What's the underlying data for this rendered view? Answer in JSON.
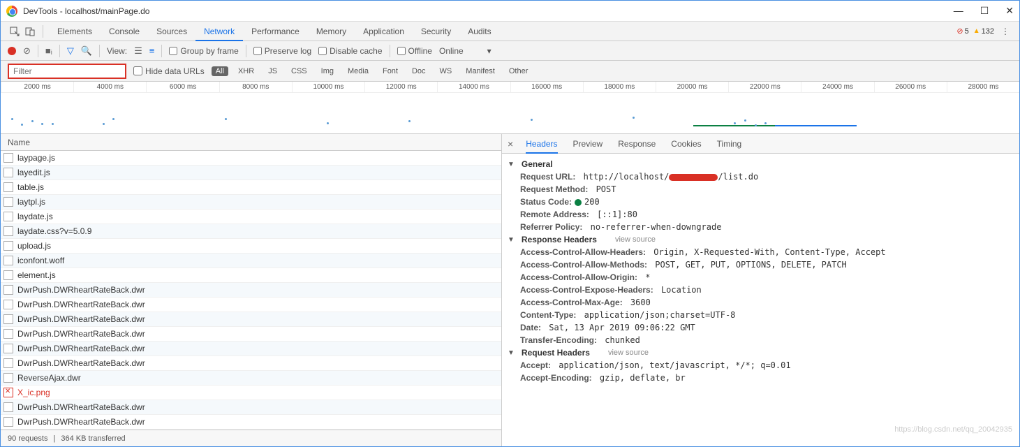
{
  "window": {
    "title": "DevTools - localhost/mainPage.do"
  },
  "errors": {
    "red": "5",
    "yellow": "132"
  },
  "tabs": [
    "Elements",
    "Console",
    "Sources",
    "Network",
    "Performance",
    "Memory",
    "Application",
    "Security",
    "Audits"
  ],
  "active_tab": "Network",
  "toolbar": {
    "view_label": "View:",
    "group_by_frame": "Group by frame",
    "preserve_log": "Preserve log",
    "disable_cache": "Disable cache",
    "offline": "Offline",
    "online": "Online"
  },
  "filter": {
    "placeholder": "Filter",
    "hide_data_urls": "Hide data URLs",
    "types": [
      "All",
      "XHR",
      "JS",
      "CSS",
      "Img",
      "Media",
      "Font",
      "Doc",
      "WS",
      "Manifest",
      "Other"
    ],
    "active_type": "All"
  },
  "timeline": {
    "ticks": [
      "2000 ms",
      "4000 ms",
      "6000 ms",
      "8000 ms",
      "10000 ms",
      "12000 ms",
      "14000 ms",
      "16000 ms",
      "18000 ms",
      "20000 ms",
      "22000 ms",
      "24000 ms",
      "26000 ms",
      "28000 ms"
    ]
  },
  "left_header": "Name",
  "requests": [
    {
      "name": "laypage.js",
      "failed": false
    },
    {
      "name": "layedit.js",
      "failed": false
    },
    {
      "name": "table.js",
      "failed": false
    },
    {
      "name": "laytpl.js",
      "failed": false
    },
    {
      "name": "laydate.js",
      "failed": false
    },
    {
      "name": "laydate.css?v=5.0.9",
      "failed": false
    },
    {
      "name": "upload.js",
      "failed": false
    },
    {
      "name": "iconfont.woff",
      "failed": false
    },
    {
      "name": "element.js",
      "failed": false
    },
    {
      "name": "DwrPush.DWRheartRateBack.dwr",
      "failed": false
    },
    {
      "name": "DwrPush.DWRheartRateBack.dwr",
      "failed": false
    },
    {
      "name": "DwrPush.DWRheartRateBack.dwr",
      "failed": false
    },
    {
      "name": "DwrPush.DWRheartRateBack.dwr",
      "failed": false
    },
    {
      "name": "DwrPush.DWRheartRateBack.dwr",
      "failed": false
    },
    {
      "name": "DwrPush.DWRheartRateBack.dwr",
      "failed": false
    },
    {
      "name": "ReverseAjax.dwr",
      "failed": false
    },
    {
      "name": "X_ic.png",
      "failed": true
    },
    {
      "name": "DwrPush.DWRheartRateBack.dwr",
      "failed": false
    },
    {
      "name": "DwrPush.DWRheartRateBack.dwr",
      "failed": false
    }
  ],
  "status": {
    "requests": "90 requests",
    "transferred": "364 KB transferred"
  },
  "detail_tabs": [
    "Headers",
    "Preview",
    "Response",
    "Cookies",
    "Timing"
  ],
  "active_detail_tab": "Headers",
  "sections": {
    "general": {
      "title": "General",
      "entries": [
        {
          "k": "Request URL:",
          "prefix": "http://localhost/",
          "suffix": "/list.do",
          "redacted": true
        },
        {
          "k": "Request Method:",
          "v": "POST"
        },
        {
          "k": "Status Code:",
          "v": "200",
          "status": true
        },
        {
          "k": "Remote Address:",
          "v": "[::1]:80"
        },
        {
          "k": "Referrer Policy:",
          "v": "no-referrer-when-downgrade"
        }
      ]
    },
    "response": {
      "title": "Response Headers",
      "view_source": "view source",
      "entries": [
        {
          "k": "Access-Control-Allow-Headers:",
          "v": "Origin, X-Requested-With, Content-Type, Accept"
        },
        {
          "k": "Access-Control-Allow-Methods:",
          "v": "POST, GET, PUT, OPTIONS, DELETE, PATCH"
        },
        {
          "k": "Access-Control-Allow-Origin:",
          "v": "*"
        },
        {
          "k": "Access-Control-Expose-Headers:",
          "v": "Location"
        },
        {
          "k": "Access-Control-Max-Age:",
          "v": "3600"
        },
        {
          "k": "Content-Type:",
          "v": "application/json;charset=UTF-8"
        },
        {
          "k": "Date:",
          "v": "Sat, 13 Apr 2019 09:06:22 GMT"
        },
        {
          "k": "Transfer-Encoding:",
          "v": "chunked"
        }
      ]
    },
    "request": {
      "title": "Request Headers",
      "view_source": "view source",
      "entries": [
        {
          "k": "Accept:",
          "v": "application/json, text/javascript, */*; q=0.01"
        },
        {
          "k": "Accept-Encoding:",
          "v": "gzip, deflate, br"
        }
      ]
    }
  },
  "watermark": "https://blog.csdn.net/qq_20042935"
}
